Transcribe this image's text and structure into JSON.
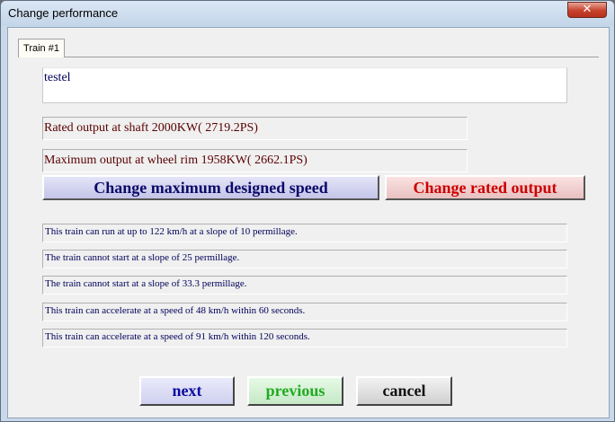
{
  "window": {
    "title": "Change performance",
    "close_glyph": "✕"
  },
  "tabs": [
    {
      "label": "Train #1"
    }
  ],
  "train": {
    "name": "testel",
    "rated_output": "Rated output at shaft   2000KW( 2719.2PS)",
    "max_output": "Maximum output at wheel rim   1958KW( 2662.1PS)"
  },
  "buttons": {
    "change_speed": "Change maximum designed  speed",
    "change_output": "Change rated output",
    "next": "next",
    "previous": "previous",
    "cancel": "cancel"
  },
  "info_lines": [
    "This train can run at up to  122 km/h at a slope of 10 permillage.",
    "The train cannot start at a slope of 25 permillage.",
    "The train cannot start at a slope of 33.3 permillage.",
    "This train can accelerate at a speed of   48 km/h within 60 seconds.",
    "This train can accelerate at a speed of   91 km/h within 120 seconds."
  ],
  "colors": {
    "accent_blue": "#0a0a6a",
    "accent_red": "#cc0000",
    "accent_green": "#22aa22",
    "close_red": "#c7422c"
  },
  "icons": {
    "close": "close-icon"
  }
}
